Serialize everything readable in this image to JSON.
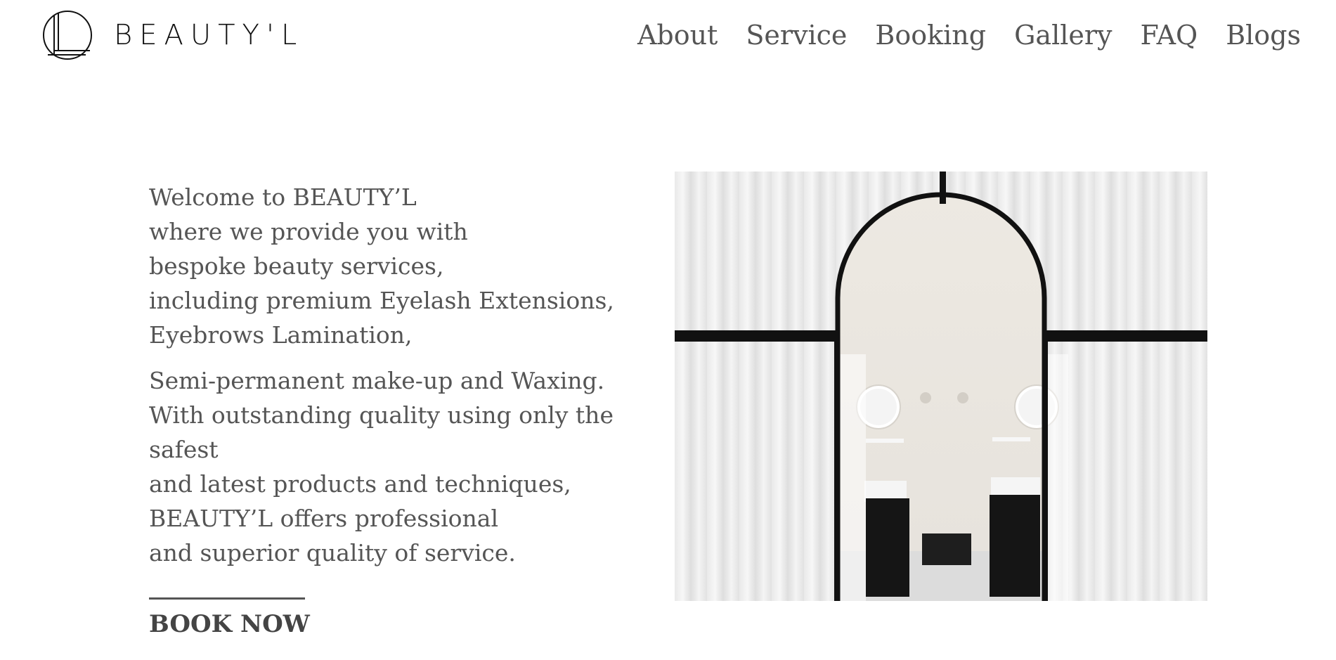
{
  "brand": {
    "name": "BEAUTY'L",
    "logo_icon": "L-monogram-circle-logo"
  },
  "nav": {
    "items": [
      "About",
      "Service",
      "Booking",
      "Gallery",
      "FAQ",
      "Blogs"
    ]
  },
  "intro": {
    "paragraph1": "Welcome to BEAUTY’L\nwhere we provide you with\nbespoke beauty services,\nincluding premium Eyelash Extensions,\nEyebrows Lamination,",
    "paragraph2": "Semi-permanent make-up and Waxing.\nWith outstanding quality using only the safest\nand latest products and techniques,\nBEAUTY’L offers professional\nand superior quality of service."
  },
  "cta": {
    "label": "BOOK NOW"
  },
  "hero_image": {
    "subject": "salon-treatment-room-arch-photo"
  }
}
